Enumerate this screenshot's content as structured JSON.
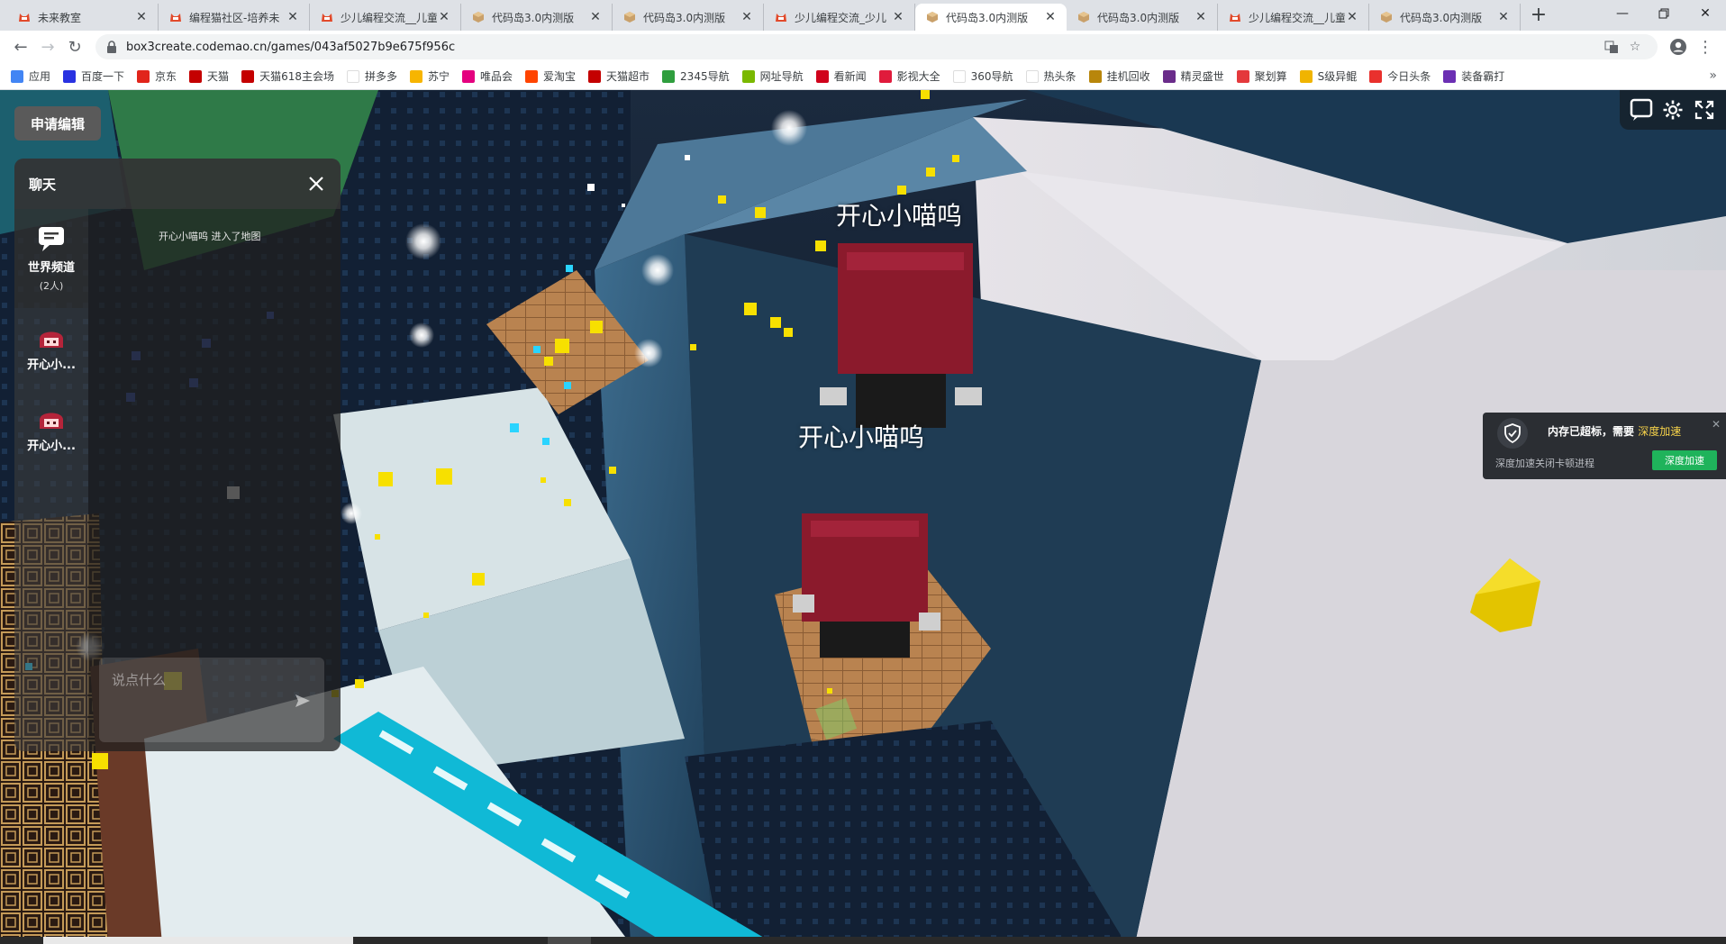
{
  "browser": {
    "tabs": [
      {
        "title": "未来教室",
        "icon": "codemao-cat-icon",
        "active": false
      },
      {
        "title": "编程猫社区-培养未",
        "icon": "codemao-cat-icon",
        "active": false
      },
      {
        "title": "少儿编程交流__儿童",
        "icon": "codemao-cat-icon",
        "active": false
      },
      {
        "title": "代码岛3.0内测版",
        "icon": "box3-cube-icon",
        "active": false
      },
      {
        "title": "代码岛3.0内测版",
        "icon": "box3-cube-icon",
        "active": false
      },
      {
        "title": "少儿编程交流_少儿",
        "icon": "codemao-cat-icon",
        "active": false
      },
      {
        "title": "代码岛3.0内测版",
        "icon": "box3-cube-icon",
        "active": true
      },
      {
        "title": "代码岛3.0内测版",
        "icon": "box3-cube-icon",
        "active": false
      },
      {
        "title": "少儿编程交流__儿童",
        "icon": "codemao-cat-icon",
        "active": false
      },
      {
        "title": "代码岛3.0内测版",
        "icon": "box3-cube-icon",
        "active": false
      }
    ],
    "new_tab": "+",
    "url": "box3create.codemao.cn/games/043af5027b9e675f956c",
    "bookmarks": [
      {
        "label": "应用",
        "color": "#4285f4"
      },
      {
        "label": "百度一下",
        "color": "#2932e1"
      },
      {
        "label": "京东",
        "color": "#e1251b"
      },
      {
        "label": "天猫",
        "color": "#c40000"
      },
      {
        "label": "天猫618主会场",
        "color": "#c40000"
      },
      {
        "label": "拼多多",
        "color": "#ffffff"
      },
      {
        "label": "苏宁",
        "color": "#f7b500"
      },
      {
        "label": "唯品会",
        "color": "#e4007f"
      },
      {
        "label": "爱淘宝",
        "color": "#ff4400"
      },
      {
        "label": "天猫超市",
        "color": "#c40000"
      },
      {
        "label": "2345导航",
        "color": "#2f9e3e"
      },
      {
        "label": "网址导航",
        "color": "#7ab800"
      },
      {
        "label": "看新闻",
        "color": "#d0021b"
      },
      {
        "label": "影视大全",
        "color": "#e01b3c"
      },
      {
        "label": "360导航",
        "color": "#ffffff"
      },
      {
        "label": "热头条",
        "color": "#ffffff"
      },
      {
        "label": "挂机回收",
        "color": "#b8860b"
      },
      {
        "label": "精灵盛世",
        "color": "#6a2c8a"
      },
      {
        "label": "聚划算",
        "color": "#e4393c"
      },
      {
        "label": "S级异鲲",
        "color": "#f0b400"
      },
      {
        "label": "今日头条",
        "color": "#e9302d"
      },
      {
        "label": "装备霸打",
        "color": "#6b2fb3"
      }
    ]
  },
  "game": {
    "edit_button": "申请编辑",
    "chat": {
      "title": "聊天",
      "world_channel": {
        "name": "世界频道",
        "count": "(2人)"
      },
      "players": [
        {
          "name": "开心小..."
        },
        {
          "name": "开心小..."
        }
      ],
      "messages": [
        {
          "text": "开心小喵呜 进入了地图"
        }
      ],
      "input_placeholder": "说点什么"
    },
    "name_tags": [
      {
        "text": "开心小喵呜"
      },
      {
        "text": "开心小喵呜"
      }
    ],
    "notification": {
      "title": "内存已超标，需要",
      "highlight": "深度加速",
      "subtitle": "深度加速关闭卡顿进程",
      "button": "深度加速"
    }
  }
}
